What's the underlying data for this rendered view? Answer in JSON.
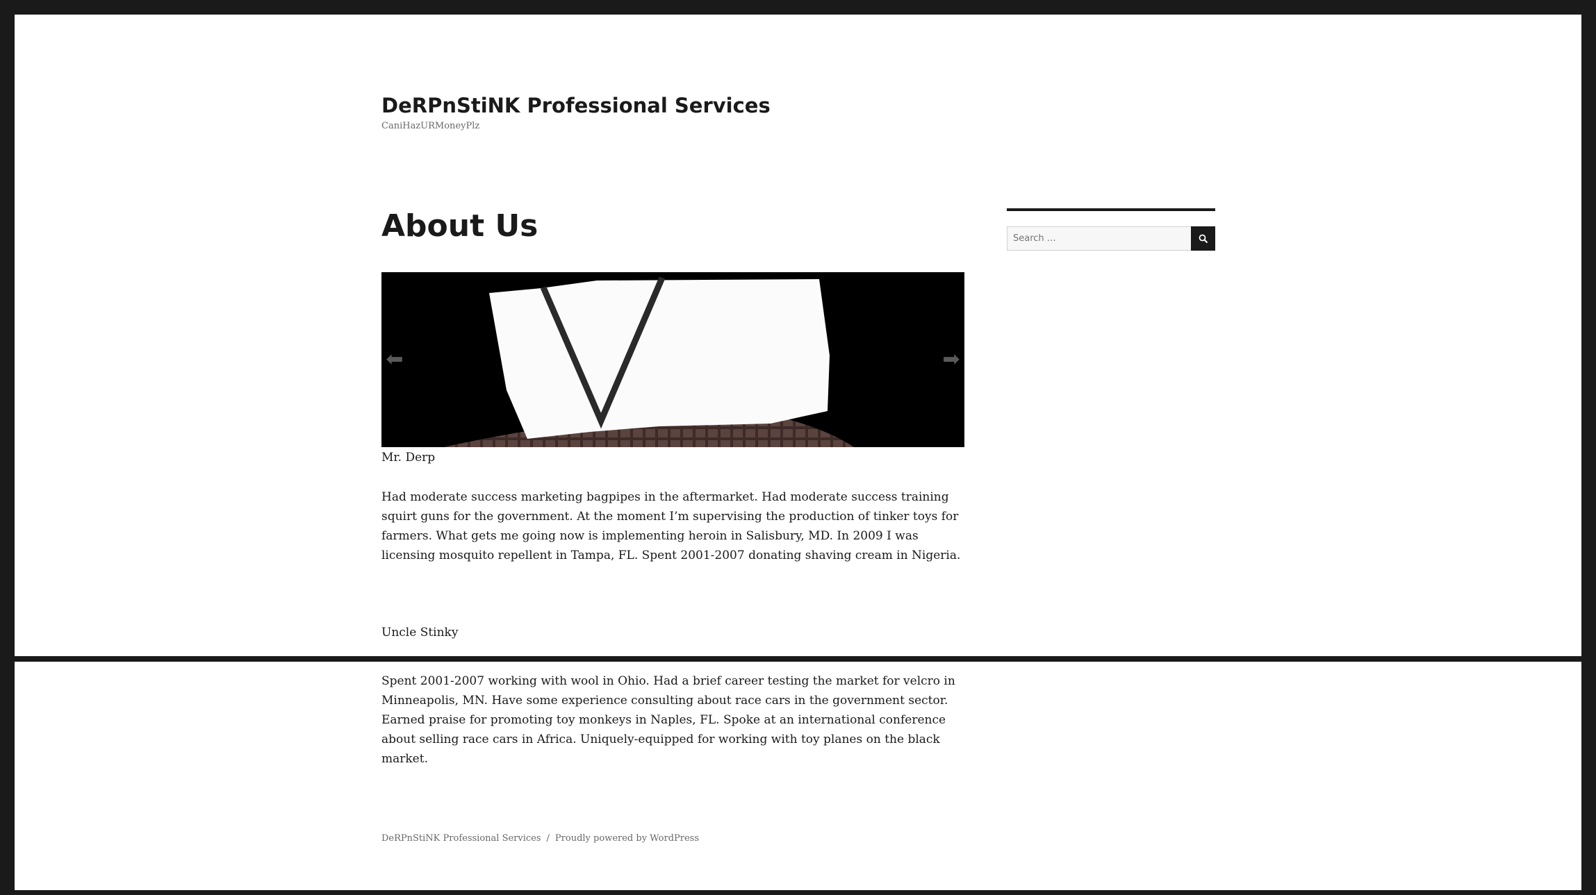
{
  "site": {
    "title": "DeRPnStiNK Professional Services",
    "description": "CaniHazURMoneyPlz"
  },
  "page": {
    "title": "About Us"
  },
  "slider": {
    "prev_icon": "arrow-left-icon",
    "next_icon": "arrow-right-icon",
    "prev_glyph": "⬅",
    "next_glyph": "➡"
  },
  "members": [
    {
      "name": "Mr. Derp",
      "bio": "Had moderate success marketing bagpipes in the aftermarket. Had moderate success training squirt guns for the government. At the moment I’m supervising the production of tinker toys for farmers. What gets me going now is implementing heroin in Salisbury, MD. In 2009 I was licensing mosquito repellent in Tampa, FL. Spent 2001-2007 donating shaving cream in Nigeria."
    },
    {
      "name": "Uncle Stinky",
      "bio": "Spent 2001-2007 working with wool in Ohio. Had a brief career testing the market for velcro in Minneapolis, MN. Have some experience consulting about race cars in the government sector. Earned praise for promoting toy monkeys in Naples, FL. Spoke at an international conference about selling race cars in Africa. Uniquely-equipped for working with toy planes on the black market."
    }
  ],
  "sidebar": {
    "search_placeholder": "Search …",
    "search_icon": "search-icon"
  },
  "footer": {
    "site_link": "DeRPnStiNK Professional Services",
    "separator": "/",
    "powered_by": "Proudly powered by WordPress"
  },
  "colors": {
    "page_background": "#1a1a1a",
    "content_background": "#ffffff",
    "text": "#1a1a1a",
    "muted_text": "#686868",
    "accent": "#1a1a1a"
  }
}
